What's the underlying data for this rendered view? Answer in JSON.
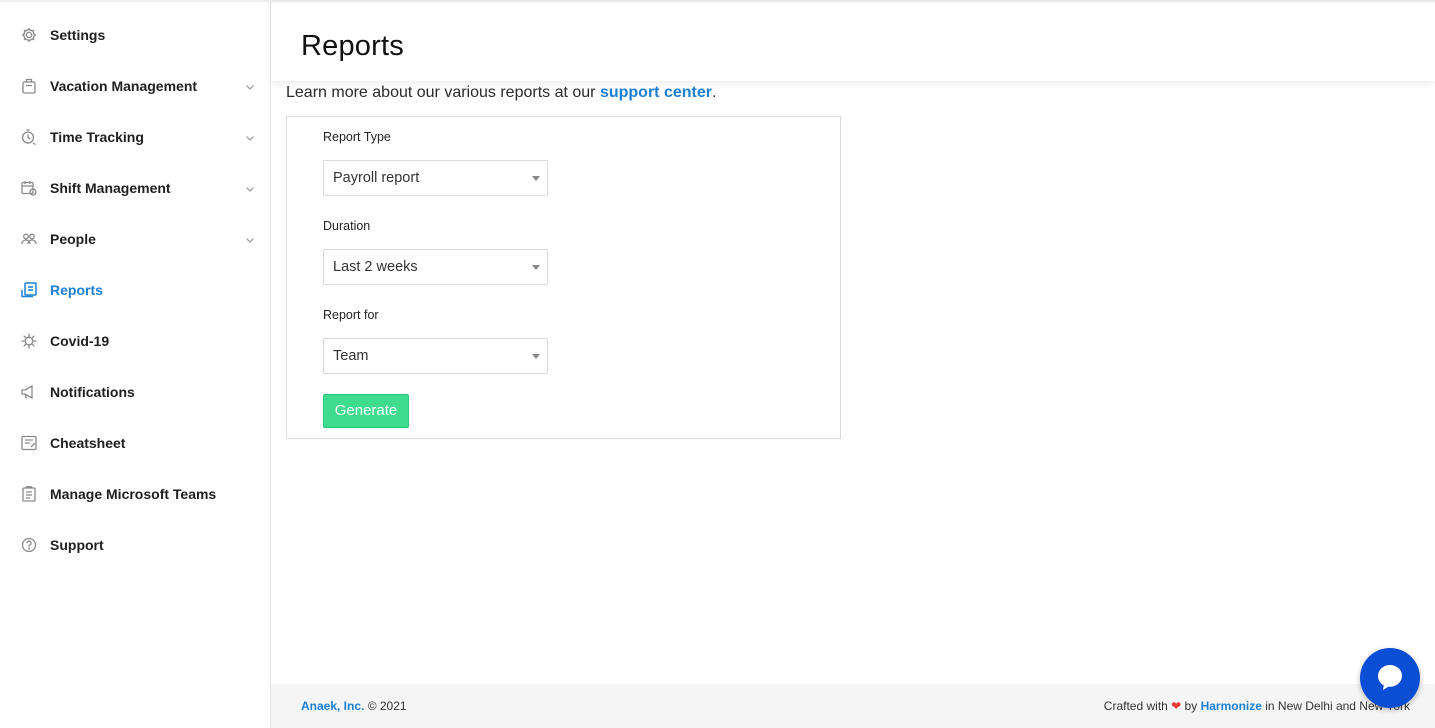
{
  "sidebar": {
    "items": [
      {
        "label": "Settings",
        "icon": "gear-icon",
        "has_chevron": false,
        "active": false
      },
      {
        "label": "Vacation Management",
        "icon": "luggage-icon",
        "has_chevron": true,
        "active": false
      },
      {
        "label": "Time Tracking",
        "icon": "stopwatch-icon",
        "has_chevron": true,
        "active": false
      },
      {
        "label": "Shift Management",
        "icon": "calendar-icon",
        "has_chevron": true,
        "active": false
      },
      {
        "label": "People",
        "icon": "people-icon",
        "has_chevron": true,
        "active": false
      },
      {
        "label": "Reports",
        "icon": "reports-icon",
        "has_chevron": false,
        "active": true
      },
      {
        "label": "Covid-19",
        "icon": "virus-icon",
        "has_chevron": false,
        "active": false
      },
      {
        "label": "Notifications",
        "icon": "megaphone-icon",
        "has_chevron": false,
        "active": false
      },
      {
        "label": "Cheatsheet",
        "icon": "cheatsheet-icon",
        "has_chevron": false,
        "active": false
      },
      {
        "label": "Manage Microsoft Teams",
        "icon": "clipboard-icon",
        "has_chevron": false,
        "active": false
      },
      {
        "label": "Support",
        "icon": "help-icon",
        "has_chevron": false,
        "active": false
      }
    ]
  },
  "header": {
    "title": "Reports"
  },
  "intro": {
    "text_before": "Learn more about our various reports at our ",
    "link_text": "support center",
    "text_after": "."
  },
  "form": {
    "report_type": {
      "label": "Report Type",
      "value": "Payroll report"
    },
    "duration": {
      "label": "Duration",
      "value": "Last 2 weeks"
    },
    "report_for": {
      "label": "Report for",
      "value": "Team"
    },
    "generate_label": "Generate"
  },
  "footer": {
    "company": "Anaek, Inc.",
    "copyright": " © 2021",
    "crafted_prefix": "Crafted with ",
    "heart": "❤",
    "by": " by ",
    "brand": "Harmonize",
    "location": " in New Delhi and New York"
  },
  "colors": {
    "accent": "#1b7fd6",
    "generate_button": "#3fdc8e",
    "chat_bubble": "#0a4fd3"
  }
}
